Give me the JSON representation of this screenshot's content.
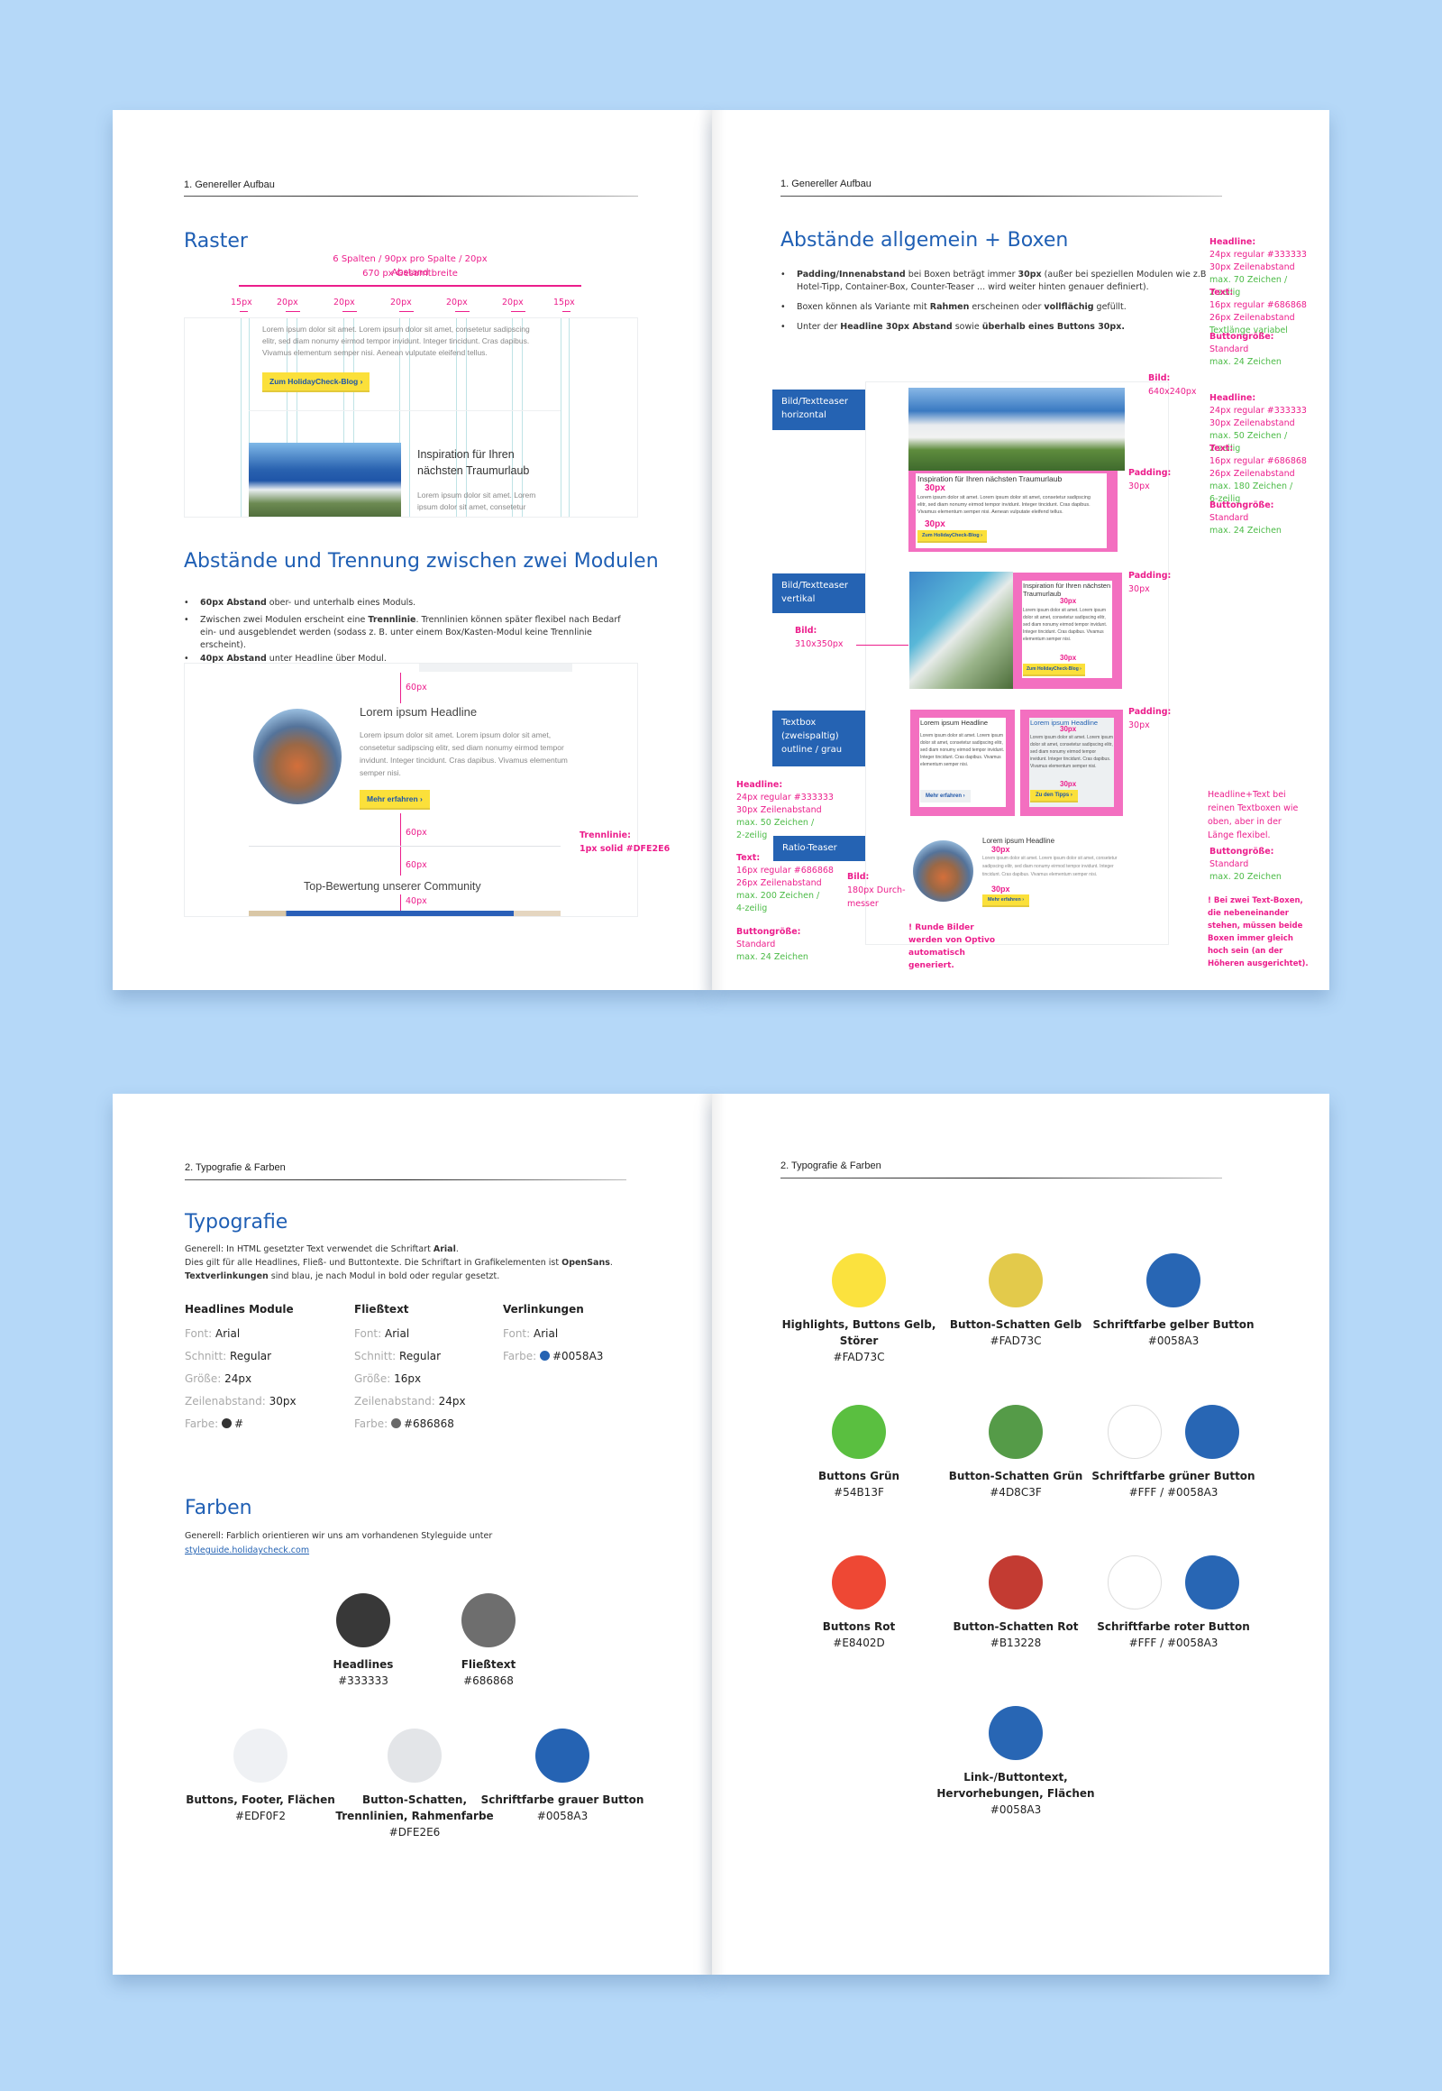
{
  "spread1": {
    "left": {
      "header": "1. Genereller Aufbau",
      "raster": {
        "title": "Raster",
        "spec1": "6 Spalten  / 90px pro Spalte / 20px Abstand",
        "spec2": "670 px Gesamtbreite",
        "gaps": [
          "15px",
          "20px",
          "20px",
          "20px",
          "20px",
          "20px",
          "15px"
        ],
        "mock_text": "Lorem ipsum dolor sit amet. Lorem ipsum dolor sit amet, consetetur sadipscing elitr, sed diam nonumy eirmod tempor invidunt. Integer tincidunt. Cras dapibus. Vivamus elementum semper nisi. Aenean vulputate eleifend tellus.",
        "mock_button": "Zum HolidayCheck-Blog ›",
        "mock_headline": "Inspiration für Ihren nächsten Traumurlaub",
        "mock_text2": "Lorem ipsum dolor sit amet. Lorem ipsum dolor sit amet, consetetur"
      },
      "abstaende": {
        "title": "Abstände und Trennung zwischen zwei Modulen",
        "bullets": [
          {
            "bold": "60px Abstand",
            "text": " ober- und unterhalb eines Moduls."
          },
          {
            "pre": "Zwischen zwei Modulen erscheint eine ",
            "bold": "Trennlinie",
            "text": ". Trennlinien können später flexibel nach Bedarf ein- und ausgeblendet werden (sodass z. B. unter einem Box/Kasten-Modul keine Trennlinie erscheint)."
          },
          {
            "bold": "40px Abstand",
            "text": " unter Headline über Modul."
          }
        ],
        "mock_headline": "Lorem ipsum Headline",
        "mock_text": "Lorem ipsum dolor sit amet. Lorem ipsum dolor sit amet, consetetur sadipscing elitr, sed diam nonumy eirmod tempor invidunt. Integer tincidunt. Cras dapibus. Vivamus elementum semper nisi.",
        "mock_button": "Mehr erfahren ›",
        "mock_headline2": "Top-Bewertung unserer Community",
        "spacing": [
          "60px",
          "60px",
          "60px",
          "40px"
        ],
        "trennlinie_label": "Trennlinie:",
        "trennlinie_value": "1px solid #DFE2E6"
      }
    },
    "right": {
      "header": "1. Genereller Aufbau",
      "title": "Abstände allgemein + Boxen",
      "bullets": [
        {
          "b1": "Padding/Innenabstand",
          "t1": " bei Boxen beträgt immer ",
          "b2": "30px",
          "t2": " (außer bei speziellen Modulen wie z.B Hotel-Tipp, Container-Box, Counter-Teaser ... wird weiter hinten genauer definiert)."
        },
        {
          "t0": "Boxen können als Variante mit ",
          "b1": "Rahmen",
          "t1": " erscheinen oder ",
          "b2": "vollflächig",
          "t2": " gefüllt."
        },
        {
          "t0": "Unter der ",
          "b1": "Headline 30px Abstand",
          "t1": " sowie ",
          "b2": "überhalb eines Buttons 30px.",
          "t2": ""
        }
      ],
      "tags": [
        "Bild/Textteaser horizontal",
        "Bild/Textteaser vertikal",
        "Textbox (zweispaltig) outline / grau",
        "Ratio-Teaser"
      ],
      "px30": "30px",
      "mock": {
        "inspiration": "Inspiration für Ihren nächsten Traumurlaub",
        "lorem_short": "Lorem ipsum dolor sit amet. Lorem ipsum dolor sit amet, consetetur sadipscing elitr, sed diam nonumy eirmod tempor invidunt. Integer tincidunt. Cras dapibus. Vivamus elementum semper nisi. Aenean vulputate eleifend tellus.",
        "lorem_box": "Lorem ipsum dolor sit amet. Lorem ipsum dolor sit amet, consetetur sadipscing elitr, sed diam nonumy eirmod tempor invidunt. Integer tincidunt. Cras dapibus. Vivamus elementum semper nisi.",
        "blog_button": "Zum HolidayCheck-Blog ›",
        "headline": "Lorem ipsum Headline",
        "more_button": "Mehr erfahren ›",
        "tips_button": "Zu den Tipps ›"
      },
      "annotations": {
        "bild1": {
          "label": "Bild:",
          "value": "640x240px"
        },
        "padding": {
          "label": "Padding:",
          "value": "30px"
        },
        "bild2": {
          "label": "Bild:",
          "value": "310x350px"
        },
        "bild3": {
          "label": "Bild:",
          "value": "180px Durch-messer"
        },
        "round_note": "! Runde Bilder werden von Optivo automatisch generiert.",
        "h1": {
          "head": "Headline:",
          "l1": "24px regular #333333",
          "l2": "30px Zeilenabstand",
          "g1": "max. 70 Zeichen /",
          "g2": "2-zeilig"
        },
        "t1": {
          "head": "Text:",
          "l1": "16px regular #686868",
          "l2": "26px Zeilenabstand",
          "g1": "Textlänge variabel"
        },
        "b1": {
          "head": "Buttongröße:",
          "l1": "Standard",
          "g1": "max. 24 Zeichen"
        },
        "h2": {
          "head": "Headline:",
          "l1": "24px regular #333333",
          "l2": "30px Zeilenabstand",
          "g1": "max. 50 Zeichen /",
          "g2": "2-zeilig"
        },
        "t2": {
          "head": "Text:",
          "l1": "16px regular #686868",
          "l2": "26px Zeilenabstand",
          "g1": "max. 180 Zeichen /",
          "g2": "6-zeilig"
        },
        "b2": {
          "head": "Buttongröße:",
          "l1": "Standard",
          "g1": "max. 24 Zeichen"
        },
        "tb": "Headline+Text bei reinen Textboxen wie oben, aber in der Länge flexibel.",
        "b3": {
          "head": "Buttongröße:",
          "l1": "Standard",
          "g1": "max. 20 Zeichen"
        },
        "tb_note": "! Bei zwei Text-Boxen, die nebeneinander stehen, müssen beide Boxen immer gleich hoch sein (an der Höheren ausgerichtet).",
        "h3": {
          "head": "Headline:",
          "l1": "24px regular #333333",
          "l2": "30px Zeilenabstand",
          "g1": "max. 50 Zeichen /",
          "g2": "2-zeilig"
        },
        "t3": {
          "head": "Text:",
          "l1": "16px regular #686868",
          "l2": "26px Zeilenabstand",
          "g1": "max. 200 Zeichen /",
          "g2": "4-zeilig"
        },
        "b4": {
          "head": "Buttongröße:",
          "l1": "Standard",
          "g1": "max. 24 Zeichen"
        }
      }
    }
  },
  "spread2": {
    "left": {
      "header": "2. Typografie & Farben",
      "typo_title": "Typografie",
      "intro1a": "Generell: In HTML gesetzter Text verwendet die Schriftart ",
      "intro1b": "Arial",
      "intro2a": "Dies gilt für alle Headlines, Fließ- und Buttontexte. Die Schriftart in Grafikelementen ist ",
      "intro2b": "OpenSans",
      "intro3a": "Textverlinkungen",
      "intro3b": " sind blau, je nach Modul in bold oder regular gesetzt.",
      "columns": [
        {
          "title": "Headlines Module",
          "rows": [
            [
              "Font:",
              "Arial"
            ],
            [
              "Schnitt:",
              "Regular"
            ],
            [
              "Größe:",
              "24px"
            ],
            [
              "Zeilenabstand:",
              "30px"
            ],
            [
              "Farbe:",
              "#"
            ]
          ],
          "color": "#333333"
        },
        {
          "title": "Fließtext",
          "rows": [
            [
              "Font:",
              "Arial"
            ],
            [
              "Schnitt:",
              "Regular"
            ],
            [
              "Größe:",
              "16px"
            ],
            [
              "Zeilenabstand:",
              "24px"
            ],
            [
              "Farbe:",
              "#686868"
            ]
          ],
          "color": "#686868"
        },
        {
          "title": "Verlinkungen",
          "rows": [
            [
              "Font:",
              "Arial"
            ],
            [
              "Farbe:",
              "#0058A3"
            ]
          ],
          "color": "#2563b3"
        }
      ],
      "farben_title": "Farben",
      "farben_intro": "Generell: Farblich orientieren wir uns am vorhandenen Styleguide unter",
      "farben_link": "styleguide.holidaycheck.com",
      "swatches": [
        {
          "label": "Headlines",
          "code": "#333333",
          "colors": [
            "#383838"
          ]
        },
        {
          "label": "Fließtext",
          "code": "#686868",
          "colors": [
            "#6e6e6e"
          ]
        },
        {
          "label": "Buttons, Footer, Flächen",
          "code": "#EDF0F2",
          "colors": [
            "#eff1f4"
          ]
        },
        {
          "label": "Button-Schatten, Trennlinien, Rahmenfarbe",
          "code": "#DFE2E6",
          "colors": [
            "#e3e5e8"
          ]
        },
        {
          "label": "Schriftfarbe grauer Button",
          "code": "#0058A3",
          "colors": [
            "#2563b3"
          ]
        }
      ]
    },
    "right": {
      "header": "2. Typografie & Farben",
      "swatches": [
        {
          "label": "Highlights, Buttons Gelb, Störer",
          "code": "#FAD73C",
          "colors": [
            "#fbe23e"
          ]
        },
        {
          "label": "Button-Schatten Gelb",
          "code": "#FAD73C",
          "colors": [
            "#e3ca4b"
          ]
        },
        {
          "label": "Schriftfarbe gelber Button",
          "code": "#0058A3",
          "colors": [
            "#2866b4"
          ]
        },
        {
          "label": "Buttons Grün",
          "code": "#54B13F",
          "colors": [
            "#5abf40"
          ]
        },
        {
          "label": "Button-Schatten Grün",
          "code": "#4D8C3F",
          "colors": [
            "#559b48"
          ]
        },
        {
          "label": "Schriftfarbe grüner Button",
          "code": "#FFF / #0058A3",
          "colors": [
            "#ffffff",
            "#2866b4"
          ]
        },
        {
          "label": "Buttons Rot",
          "code": "#E8402D",
          "colors": [
            "#ee4834"
          ]
        },
        {
          "label": "Button-Schatten Rot",
          "code": "#B13228",
          "colors": [
            "#c33b32"
          ]
        },
        {
          "label": "Schriftfarbe roter Button",
          "code": "#FFF / #0058A3",
          "colors": [
            "#ffffff",
            "#2866b4"
          ]
        },
        {
          "label": "Link-/Buttontext, Hervorhebungen, Flächen",
          "code": "#0058A3",
          "colors": [
            "#2866b4"
          ]
        }
      ]
    }
  },
  "colors": {
    "background": "#b5d8f8",
    "accent_blue": "#1f5fb4",
    "annotation_pink": "#ec1e8c",
    "annotation_green": "#4cbb47",
    "box_pink": "#f36fc0"
  }
}
